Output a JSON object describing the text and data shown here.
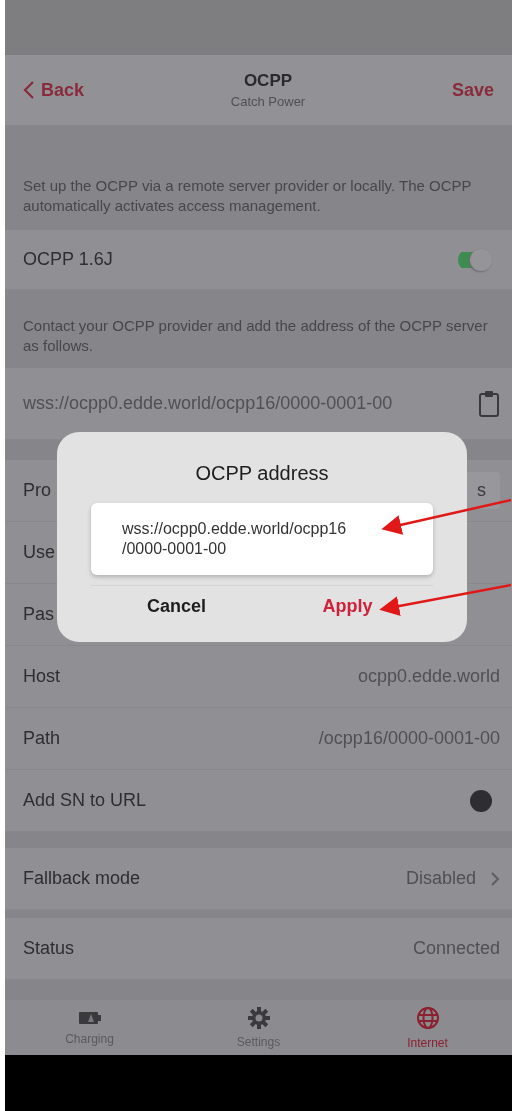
{
  "header": {
    "back": "Back",
    "title": "OCPP",
    "subtitle": "Catch Power",
    "save": "Save"
  },
  "intro": "Set up the OCPP via a remote server provider or locally. The OCPP automatically activates access management.",
  "ocpp_toggle": {
    "label": "OCPP 1.6J",
    "on": true
  },
  "instructions": "Contact your OCPP provider and add the address of the OCPP server as follows.",
  "server_url": {
    "value": "wss://ocpp0.edde.world/ocpp16/0000-0001-00"
  },
  "settings_rows": [
    {
      "kind": "chip",
      "label": "Pro",
      "value": "s"
    },
    {
      "kind": "text",
      "label": "Use"
    },
    {
      "kind": "text",
      "label": "Pas"
    },
    {
      "kind": "text",
      "label": "Host",
      "value": "ocpp0.edde.world"
    },
    {
      "kind": "text",
      "label": "Path",
      "value": "/ocpp16/0000-0001-00"
    },
    {
      "kind": "toggle",
      "label": "Add SN to URL",
      "on": false
    }
  ],
  "fallback": {
    "label": "Fallback mode",
    "value": "Disabled"
  },
  "status": {
    "label": "Status",
    "value": "Connected"
  },
  "tabs": [
    {
      "label": "Charging",
      "selected": false
    },
    {
      "label": "Settings",
      "selected": false
    },
    {
      "label": "Internet",
      "selected": true
    }
  ],
  "dialog": {
    "title": "OCPP address",
    "value": "wss://ocpp0.edde.world/ocpp16/0000-0001-00",
    "cancel": "Cancel",
    "apply": "Apply"
  }
}
